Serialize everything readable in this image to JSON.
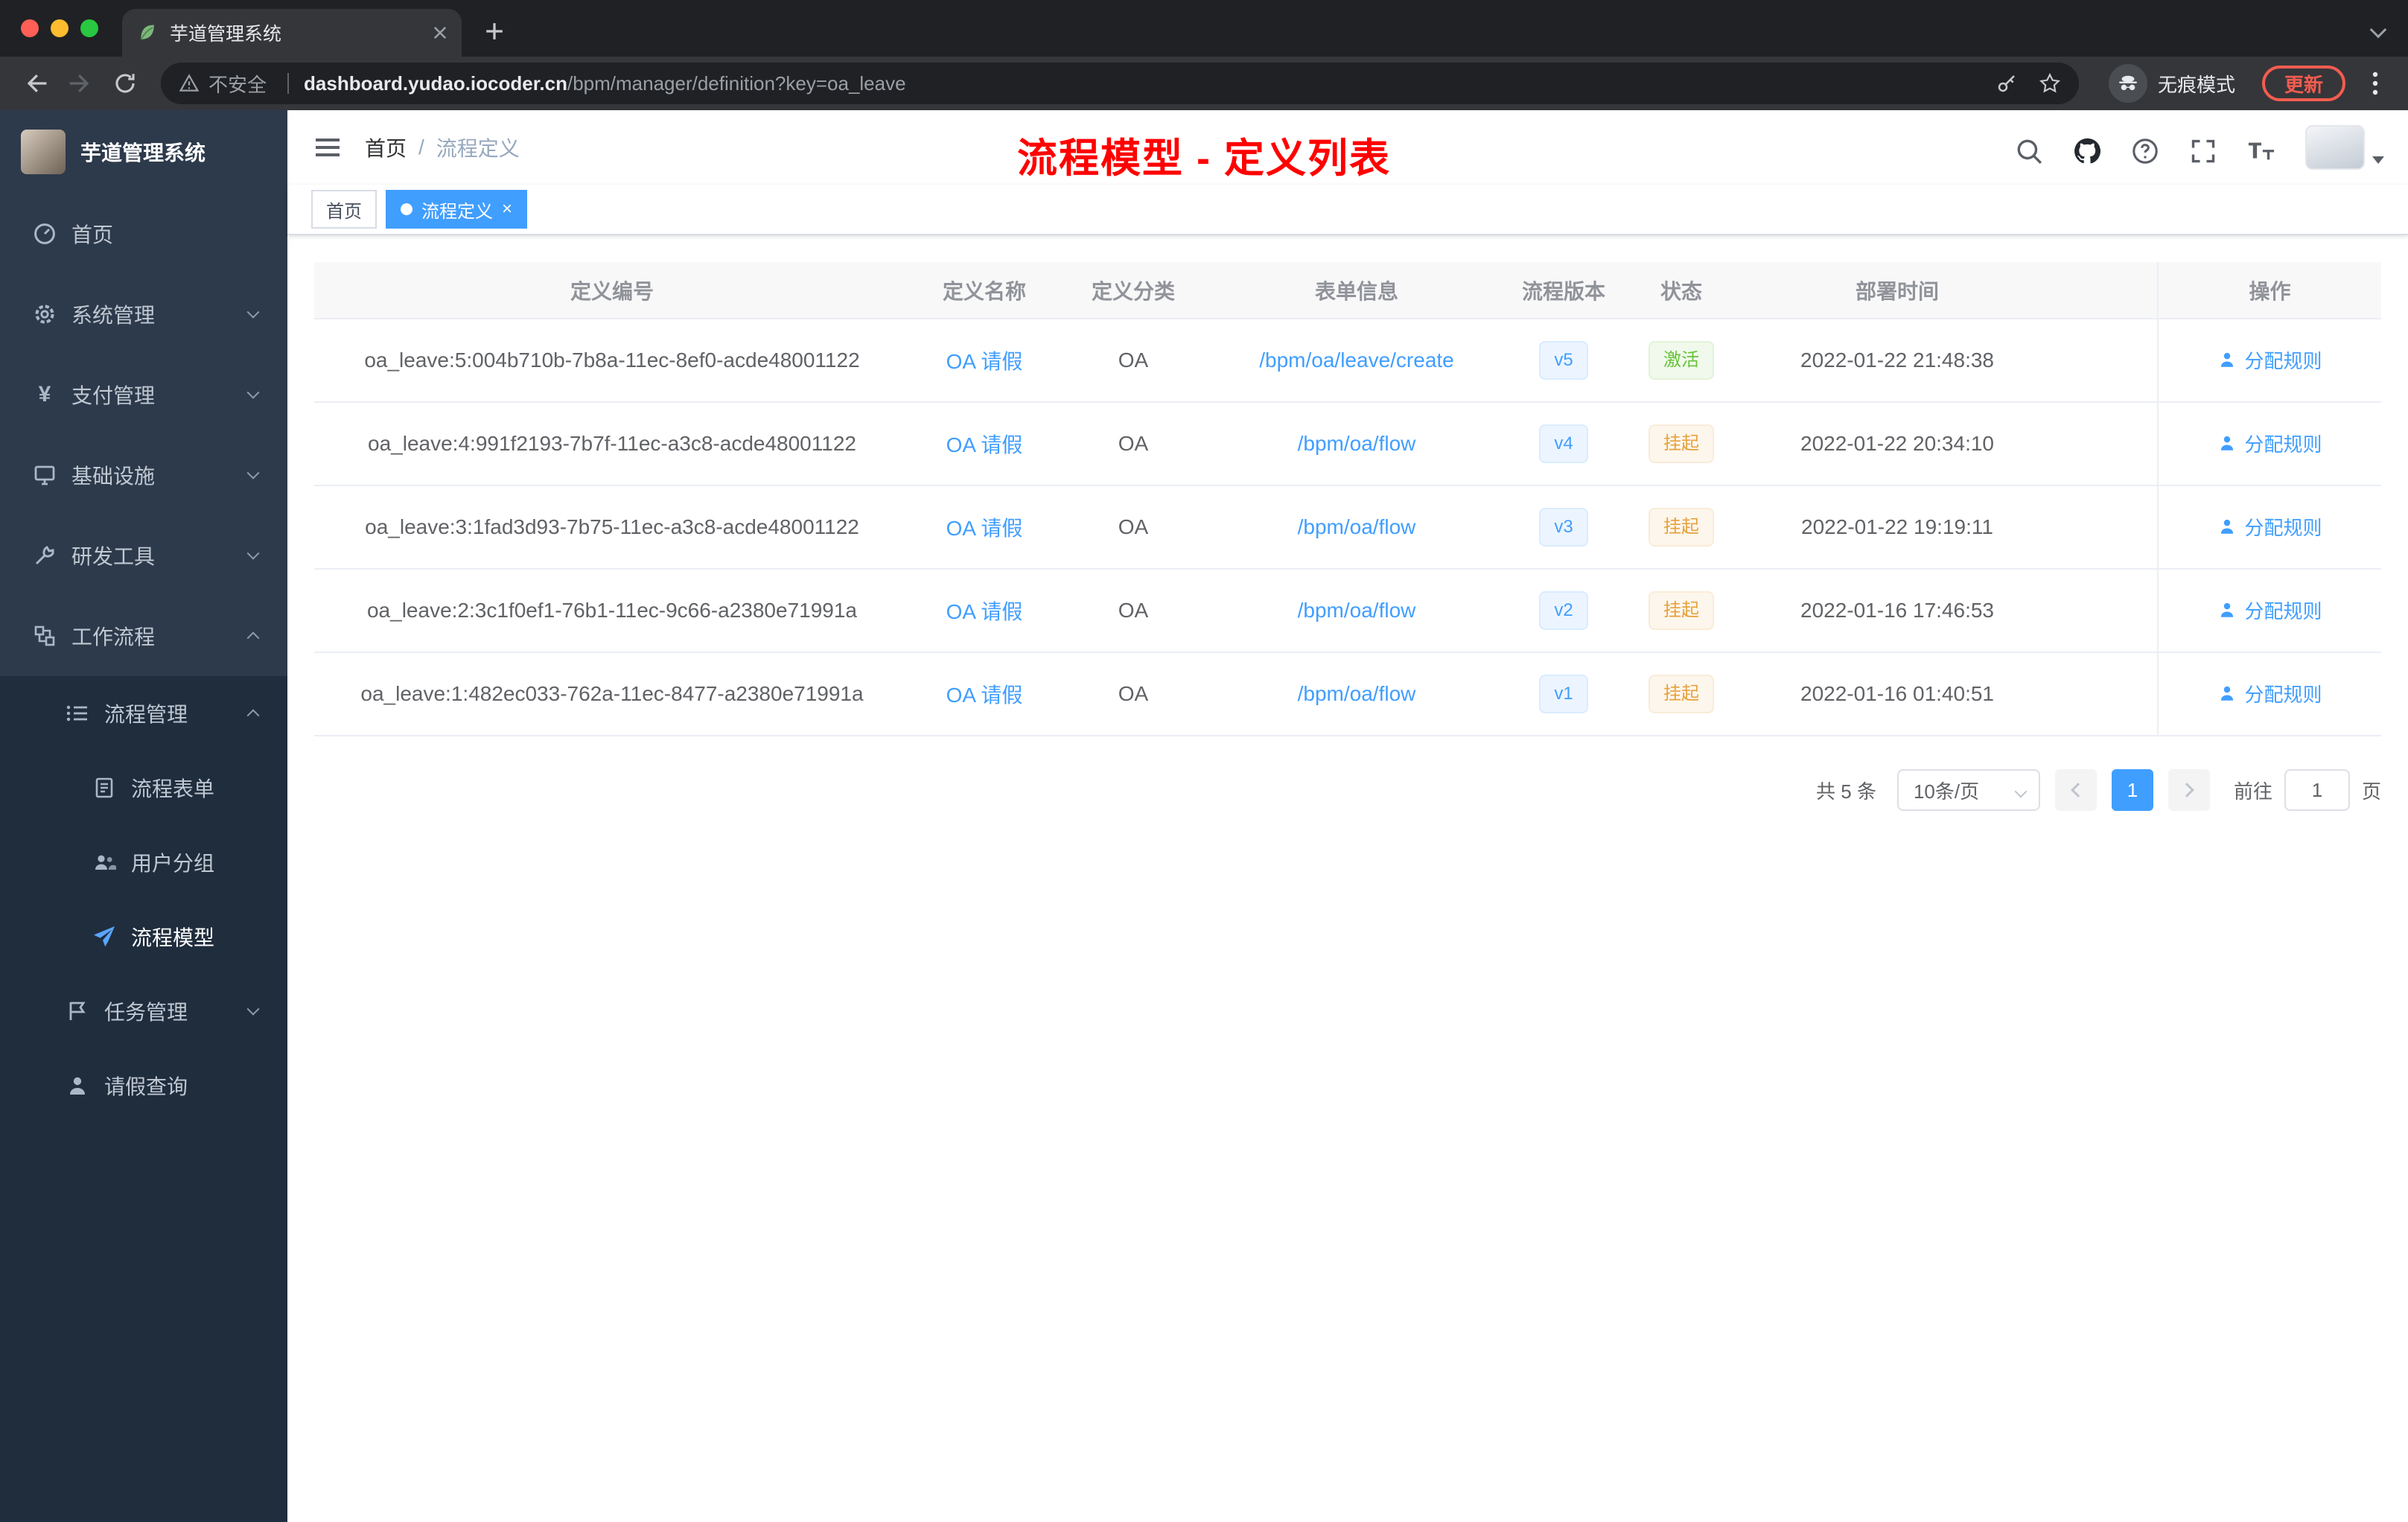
{
  "browser": {
    "tab": {
      "title": "芋道管理系统",
      "close": "×",
      "new_tab": "+"
    },
    "url": {
      "security": "不安全",
      "host": "dashboard.yudao.iocoder.cn",
      "path": "/bpm/manager/definition?key=oa_leave"
    },
    "incognito_label": "无痕模式",
    "update_label": "更新"
  },
  "sidebar": {
    "logo_title": "芋道管理系统",
    "items": [
      {
        "label": "首页"
      },
      {
        "label": "系统管理"
      },
      {
        "label": "支付管理"
      },
      {
        "label": "基础设施"
      },
      {
        "label": "研发工具"
      },
      {
        "label": "工作流程"
      },
      {
        "label": "流程管理"
      },
      {
        "label": "流程表单"
      },
      {
        "label": "用户分组"
      },
      {
        "label": "流程模型"
      },
      {
        "label": "任务管理"
      },
      {
        "label": "请假查询"
      }
    ]
  },
  "header": {
    "breadcrumb": {
      "home": "首页",
      "sep": "/",
      "current": "流程定义"
    },
    "annotation": "流程模型 - 定义列表"
  },
  "tags": {
    "home": "首页",
    "active": "流程定义",
    "close": "×"
  },
  "table": {
    "columns": {
      "id": "定义编号",
      "name": "定义名称",
      "category": "定义分类",
      "form": "表单信息",
      "version": "流程版本",
      "status": "状态",
      "time": "部署时间",
      "action": "操作"
    },
    "rows": [
      {
        "id": "oa_leave:5:004b710b-7b8a-11ec-8ef0-acde48001122",
        "name": "OA 请假",
        "category": "OA",
        "form": "/bpm/oa/leave/create",
        "version": "v5",
        "status": "激活",
        "status_type": "success",
        "time": "2022-01-22 21:48:38",
        "action": "分配规则"
      },
      {
        "id": "oa_leave:4:991f2193-7b7f-11ec-a3c8-acde48001122",
        "name": "OA 请假",
        "category": "OA",
        "form": "/bpm/oa/flow",
        "version": "v4",
        "status": "挂起",
        "status_type": "warning",
        "time": "2022-01-22 20:34:10",
        "action": "分配规则"
      },
      {
        "id": "oa_leave:3:1fad3d93-7b75-11ec-a3c8-acde48001122",
        "name": "OA 请假",
        "category": "OA",
        "form": "/bpm/oa/flow",
        "version": "v3",
        "status": "挂起",
        "status_type": "warning",
        "time": "2022-01-22 19:19:11",
        "action": "分配规则"
      },
      {
        "id": "oa_leave:2:3c1f0ef1-76b1-11ec-9c66-a2380e71991a",
        "name": "OA 请假",
        "category": "OA",
        "form": "/bpm/oa/flow",
        "version": "v2",
        "status": "挂起",
        "status_type": "warning",
        "time": "2022-01-16 17:46:53",
        "action": "分配规则"
      },
      {
        "id": "oa_leave:1:482ec033-762a-11ec-8477-a2380e71991a",
        "name": "OA 请假",
        "category": "OA",
        "form": "/bpm/oa/flow",
        "version": "v1",
        "status": "挂起",
        "status_type": "warning",
        "time": "2022-01-16 01:40:51",
        "action": "分配规则"
      }
    ]
  },
  "pagination": {
    "total": "共 5 条",
    "page_size": "10条/页",
    "page": "1",
    "goto_label": "前往",
    "goto_value": "1",
    "unit_label": "页"
  }
}
